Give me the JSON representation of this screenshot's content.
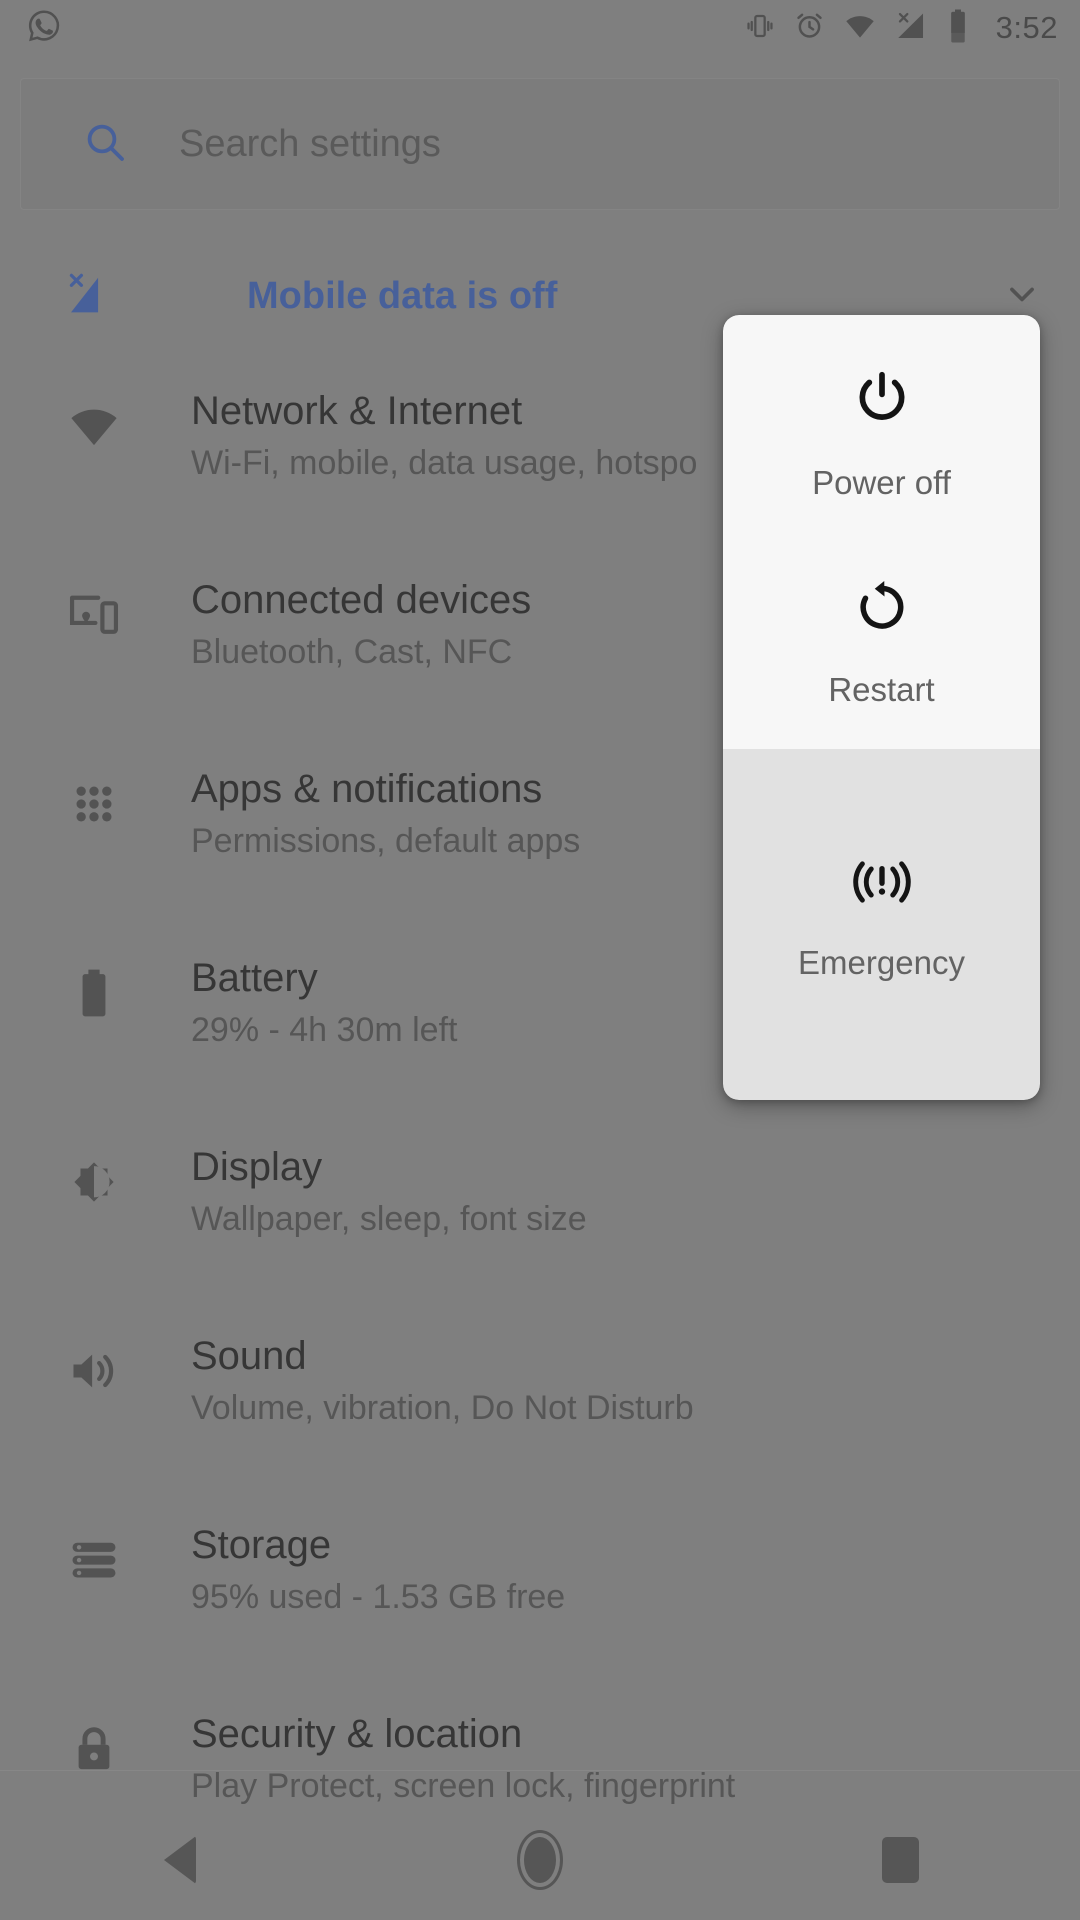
{
  "status_bar": {
    "notification_icons": [
      "whatsapp-icon"
    ],
    "system_icons": [
      "vibrate-icon",
      "alarm-icon",
      "wifi-icon",
      "mobile-signal-off-icon",
      "battery-icon"
    ],
    "time": "3:52"
  },
  "search": {
    "placeholder": "Search settings",
    "icon": "search-icon",
    "accent_color": "#3a64c8"
  },
  "mobile_data_banner": {
    "label": "Mobile data is off",
    "icon": "signal-off-icon",
    "chevron": "chevron-down-icon",
    "color": "#3a64c8"
  },
  "settings": {
    "items": [
      {
        "icon": "wifi-icon",
        "title": "Network & Internet",
        "subtitle": "Wi-Fi, mobile, data usage, hotspo"
      },
      {
        "icon": "connected-devices-icon",
        "title": "Connected devices",
        "subtitle": "Bluetooth, Cast, NFC"
      },
      {
        "icon": "apps-grid-icon",
        "title": "Apps & notifications",
        "subtitle": "Permissions, default apps"
      },
      {
        "icon": "battery-icon",
        "title": "Battery",
        "subtitle": "29% - 4h 30m left"
      },
      {
        "icon": "brightness-icon",
        "title": "Display",
        "subtitle": "Wallpaper, sleep, font size"
      },
      {
        "icon": "volume-icon",
        "title": "Sound",
        "subtitle": "Volume, vibration, Do Not Disturb"
      },
      {
        "icon": "storage-icon",
        "title": "Storage",
        "subtitle": "95% used - 1.53 GB free"
      },
      {
        "icon": "lock-icon",
        "title": "Security & location",
        "subtitle": "Play Protect, screen lock, fingerprint"
      }
    ]
  },
  "power_dialog": {
    "background_primary": "#f7f7f7",
    "background_secondary": "#e1e1e1",
    "options": [
      {
        "label": "Power off",
        "icon": "power-icon"
      },
      {
        "label": "Restart",
        "icon": "restart-icon"
      },
      {
        "label": "Emergency",
        "icon": "emergency-icon"
      }
    ]
  },
  "nav_bar": {
    "buttons": [
      {
        "name": "back",
        "icon": "back-triangle-icon"
      },
      {
        "name": "home",
        "icon": "home-circle-icon"
      },
      {
        "name": "recents",
        "icon": "recents-square-icon"
      }
    ]
  }
}
